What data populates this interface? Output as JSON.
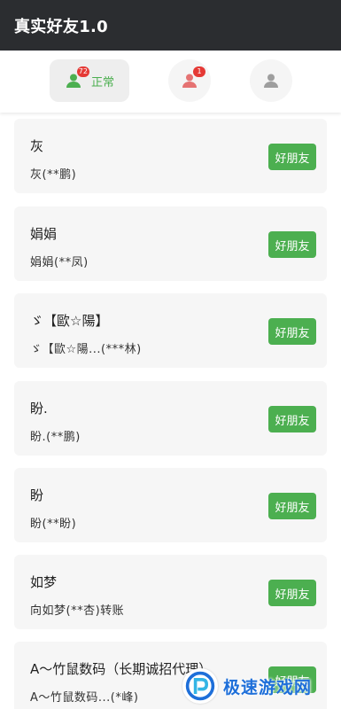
{
  "app": {
    "title": "真实好友1.0"
  },
  "tabs": {
    "normal": {
      "label": "正常",
      "badge": "72",
      "color": "#4caf50"
    },
    "flagged": {
      "badge": "1",
      "color": "#e57373"
    },
    "other": {
      "color": "#9e9e9e"
    }
  },
  "friends": [
    {
      "name": "灰",
      "sub": "灰(**鹏)",
      "button": "好朋友"
    },
    {
      "name": "娟娟",
      "sub": "娟娟(**凤)",
      "button": "好朋友"
    },
    {
      "name": "ゞ【歐☆陽】",
      "sub": "ゞ【歐☆陽...(***林)",
      "button": "好朋友"
    },
    {
      "name": "盼.",
      "sub": "盼.(**鹏)",
      "button": "好朋友"
    },
    {
      "name": "盼",
      "sub": "盼(**盼)",
      "button": "好朋友"
    },
    {
      "name": "如梦",
      "sub": "向如梦(**杏)转账",
      "button": "好朋友"
    },
    {
      "name": "A～竹鼠数码（长期诚招代理）",
      "sub": "A～竹鼠数码...(*峰)",
      "button": "好朋友"
    }
  ],
  "watermark": {
    "text": "极速游戏网"
  },
  "colors": {
    "accent": "#4caf50",
    "titlebar": "#2b2d30",
    "card": "#f6f6f6"
  }
}
